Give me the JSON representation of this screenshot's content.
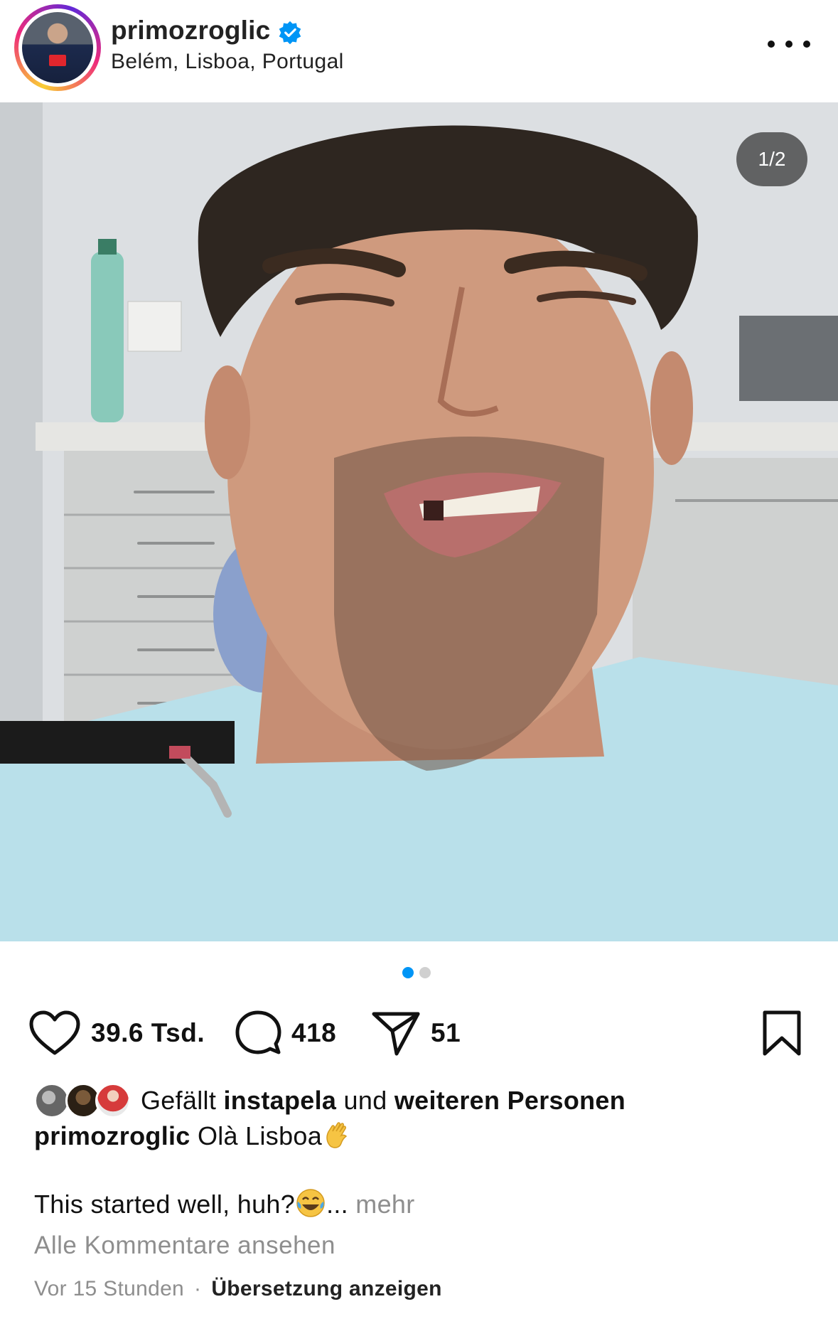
{
  "post_header": {
    "username": "primozroglic",
    "verified": true,
    "location": "Belém, Lisboa, Portugal",
    "avatar_icon": "profile-avatar",
    "more_icon": "more-options-icon"
  },
  "media": {
    "counter": "1/2",
    "active_index": 1,
    "total": 2
  },
  "actions": {
    "likes": "39.6 Tsd.",
    "comments": "418",
    "shares": "51",
    "icons": [
      "heart-icon",
      "comment-icon",
      "share-icon",
      "bookmark-icon"
    ]
  },
  "liked_by": {
    "prefix": "Gefällt",
    "user": "instapela",
    "connector": "und",
    "others": "weiteren Personen"
  },
  "caption": {
    "username": "primozroglic",
    "text": "Olà Lisboa",
    "line2": "This started well, huh?",
    "ellipsis": "...",
    "more": "mehr"
  },
  "comments": {
    "view_all": "Alle Kommentare ansehen"
  },
  "meta": {
    "time": "Vor 15 Stunden",
    "separator": "·",
    "translate": "Übersetzung anzeigen"
  },
  "colors": {
    "accent": "#0095f6",
    "verified": "#0095f6",
    "muted": "#8e8e8e"
  }
}
